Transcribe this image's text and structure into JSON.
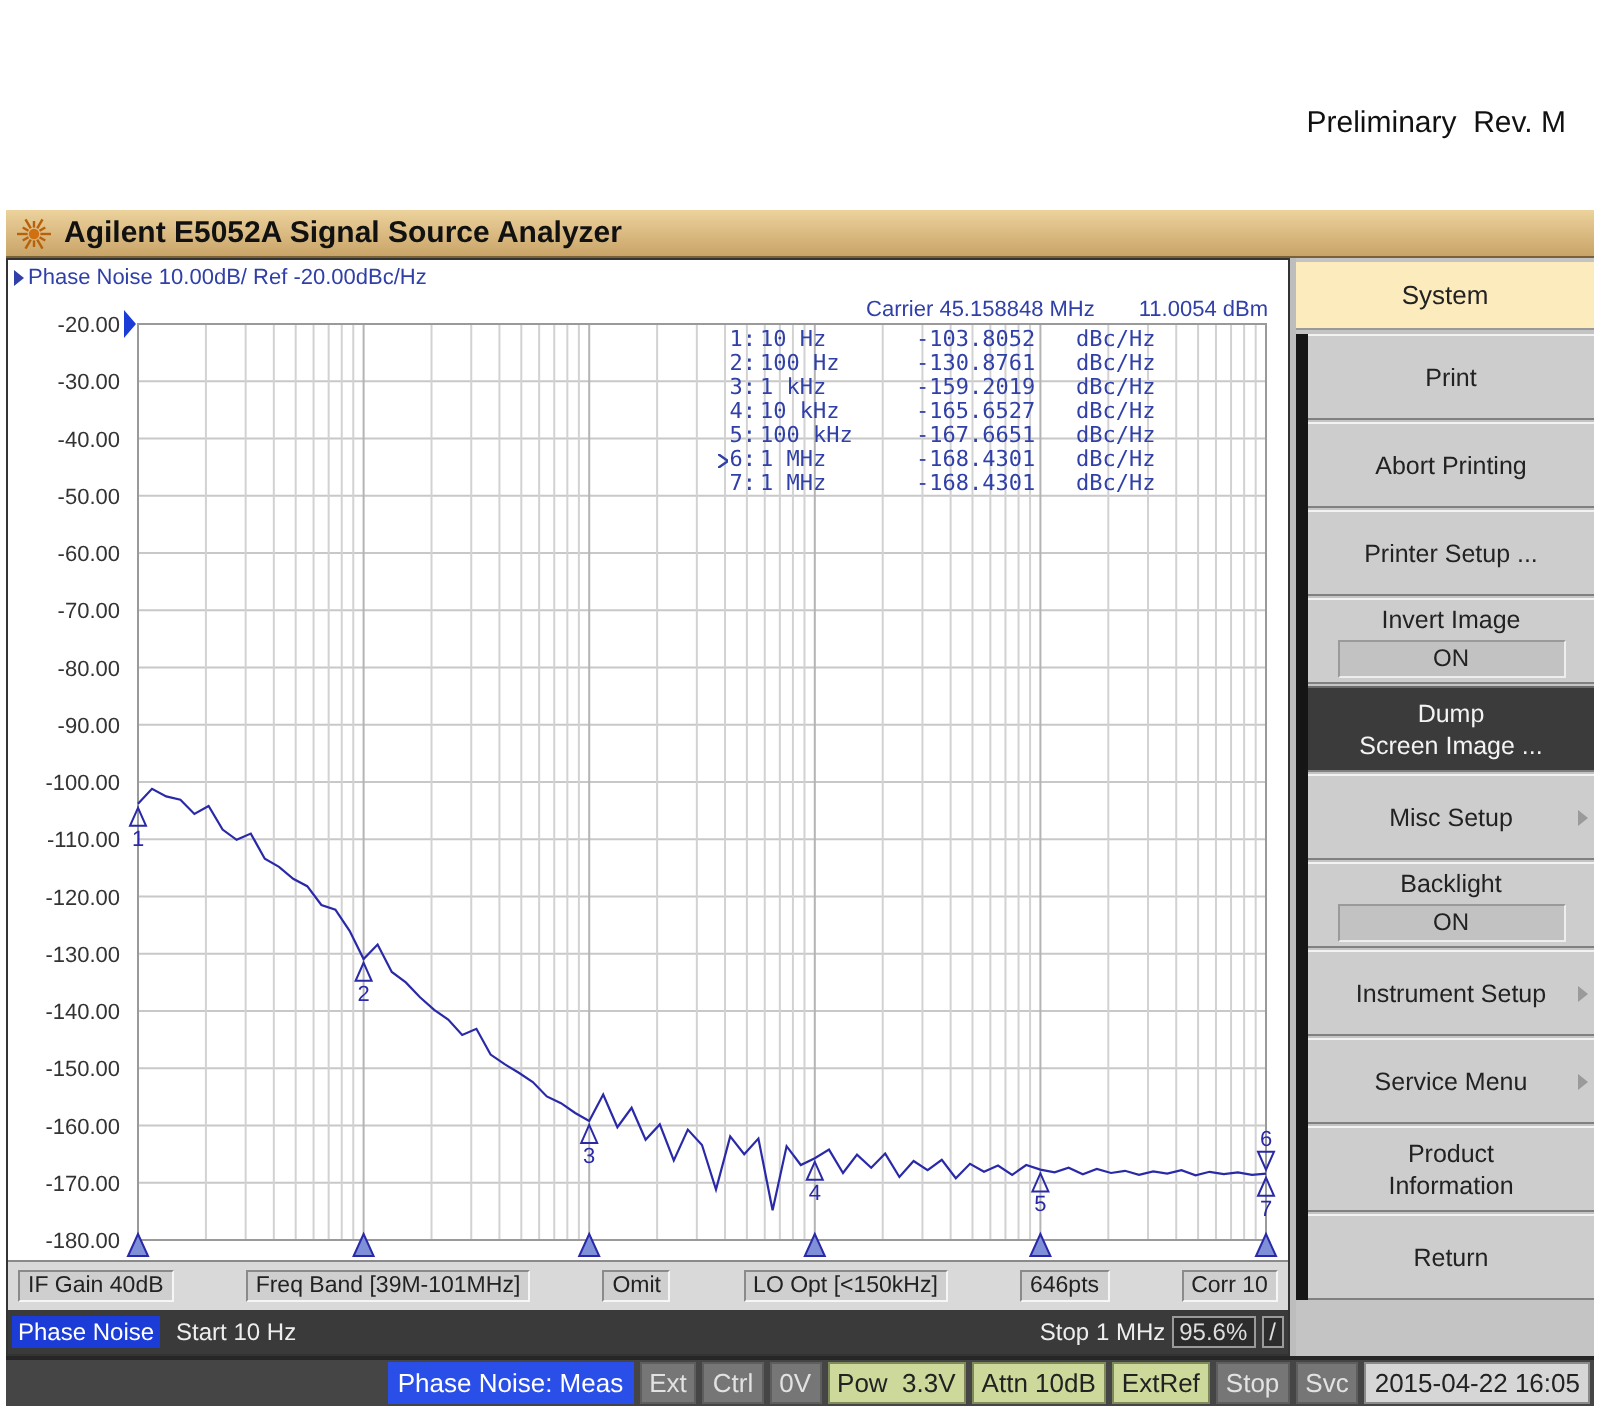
{
  "page_header": {
    "text": "Preliminary  Rev. M"
  },
  "window": {
    "title": "Agilent E5052A Signal Source Analyzer"
  },
  "trace_panel": {
    "carrier": "Carrier 45.158848 MHz",
    "carrier_power": "11.0054 dBm",
    "markers": [
      {
        "number": "1:",
        "stimulus": "10 Hz",
        "value": "-103.8052",
        "unit": "dBc/Hz",
        "selected": false
      },
      {
        "number": "2:",
        "stimulus": "100 Hz",
        "value": "-130.8761",
        "unit": "dBc/Hz",
        "selected": false
      },
      {
        "number": "3:",
        "stimulus": "1 kHz",
        "value": "-159.2019",
        "unit": "dBc/Hz",
        "selected": false
      },
      {
        "number": "4:",
        "stimulus": "10 kHz",
        "value": "-165.6527",
        "unit": "dBc/Hz",
        "selected": false
      },
      {
        "number": "5:",
        "stimulus": "100 kHz",
        "value": "-167.6651",
        "unit": "dBc/Hz",
        "selected": false
      },
      {
        "number": "6:",
        "stimulus": "1 MHz",
        "value": "-168.4301",
        "unit": "dBc/Hz",
        "selected": true
      },
      {
        "number": "7:",
        "stimulus": "1 MHz",
        "value": "-168.4301",
        "unit": "dBc/Hz",
        "selected": false
      }
    ],
    "chart_data": {
      "type": "line",
      "title": "Phase Noise 10.00dB/ Ref -20.00dBc/Hz",
      "categories": [
        null,
        null,
        null,
        null,
        null,
        null,
        null,
        null,
        null,
        null,
        null,
        null,
        null,
        null,
        null,
        null,
        null,
        null,
        null,
        null,
        null,
        null,
        null,
        null,
        null,
        null,
        null,
        null,
        null,
        null,
        null,
        null,
        null,
        null,
        null,
        null,
        null,
        null,
        null,
        null,
        null,
        null,
        null,
        null,
        null,
        null,
        null,
        null,
        null,
        null,
        null,
        null,
        null,
        null,
        null,
        null,
        null,
        null,
        null,
        null,
        null,
        null,
        null,
        null,
        null,
        null,
        null,
        null,
        null,
        null,
        null,
        null,
        null,
        null,
        null,
        null,
        null,
        null,
        null,
        null,
        null
      ],
      "values": [
        -103.8,
        -101.2,
        -102.5,
        -103.1,
        -105.6,
        -104.2,
        -108.3,
        -110.1,
        -109.0,
        -113.4,
        -114.8,
        -116.9,
        -118.2,
        -121.5,
        -122.3,
        -126.0,
        -130.9,
        -128.4,
        -133.2,
        -135.0,
        -137.6,
        -139.8,
        -141.5,
        -144.2,
        -143.1,
        -147.6,
        -149.3,
        -150.8,
        -152.4,
        -154.9,
        -156.1,
        -157.8,
        -159.2,
        -154.6,
        -160.3,
        -156.9,
        -162.5,
        -159.8,
        -166.1,
        -160.7,
        -163.4,
        -171.2,
        -161.9,
        -165.0,
        -162.3,
        -174.8,
        -163.6,
        -166.9,
        -165.7,
        -164.2,
        -168.3,
        -165.1,
        -167.4,
        -164.9,
        -169.0,
        -166.2,
        -167.8,
        -166.0,
        -169.2,
        -166.7,
        -168.1,
        -167.0,
        -168.6,
        -166.9,
        -167.7,
        -168.2,
        -167.4,
        -168.5,
        -167.6,
        -168.3,
        -167.9,
        -168.6,
        -168.0,
        -168.4,
        -167.8,
        -168.7,
        -168.1,
        -168.5,
        -168.2,
        -168.6,
        -168.4
      ],
      "ylim": [
        -180,
        -20
      ],
      "yticks": [
        {
          "value": -20,
          "label": "-20.00"
        },
        {
          "value": -30,
          "label": "-30.00"
        },
        {
          "value": -40,
          "label": "-40.00"
        },
        {
          "value": -50,
          "label": "-50.00"
        },
        {
          "value": -60,
          "label": "-60.00"
        },
        {
          "value": -70,
          "label": "-70.00"
        },
        {
          "value": -80,
          "label": "-80.00"
        },
        {
          "value": -90,
          "label": "-90.00"
        },
        {
          "value": -100,
          "label": "-100.00"
        },
        {
          "value": -110,
          "label": "-110.00"
        },
        {
          "value": -120,
          "label": "-120.00"
        },
        {
          "value": -130,
          "label": "-130.00"
        },
        {
          "value": -140,
          "label": "-140.00"
        },
        {
          "value": -150,
          "label": "-150.00"
        },
        {
          "value": -160,
          "label": "-160.00"
        },
        {
          "value": -170,
          "label": "-170.00"
        },
        {
          "value": -180,
          "label": "-180.00"
        }
      ],
      "grid": true,
      "annotations": [
        {
          "y": -103.8052,
          "text": "1"
        },
        {
          "y": -130.8761,
          "text": "2"
        },
        {
          "y": -159.2019,
          "text": "3"
        },
        {
          "y": -165.6527,
          "text": "4"
        },
        {
          "y": -167.6651,
          "text": "5"
        },
        {
          "y": -168.4301,
          "text": "6"
        },
        {
          "y": -168.4301,
          "text": "7"
        }
      ]
    },
    "settings": [
      "IF Gain 40dB",
      "Freq Band [39M-101MHz]",
      "Omit",
      "LO Opt [<150kHz]",
      "646pts",
      "Corr 10"
    ],
    "sweep": {
      "trace_label": "Phase Noise",
      "start": "Start 10 Hz",
      "stop": "Stop 1 MHz",
      "progress": "95.6%",
      "indicator": "/"
    }
  },
  "softkeys": {
    "title": "System",
    "items": [
      {
        "label": "Print",
        "kind": "action",
        "selected": false
      },
      {
        "label": "Abort Printing",
        "kind": "action",
        "selected": false
      },
      {
        "label": "Printer Setup ...",
        "kind": "action",
        "selected": false
      },
      {
        "label": "Invert Image",
        "kind": "toggle",
        "value": "ON",
        "selected": false
      },
      {
        "label": "Dump\nScreen Image ...",
        "kind": "action",
        "selected": true
      },
      {
        "label": "Misc Setup",
        "kind": "submenu",
        "selected": false
      },
      {
        "label": "Backlight",
        "kind": "toggle",
        "value": "ON",
        "selected": false
      },
      {
        "label": "Instrument Setup",
        "kind": "submenu",
        "selected": false
      },
      {
        "label": "Service Menu",
        "kind": "submenu",
        "selected": false
      },
      {
        "label": "Product\nInformation",
        "kind": "action",
        "selected": false
      },
      {
        "label": "Return",
        "kind": "action",
        "selected": false
      }
    ]
  },
  "status_bar": [
    {
      "label": "Phase Noise: Meas",
      "kind": "mode"
    },
    {
      "label": "Ext",
      "kind": "indicator",
      "on": false
    },
    {
      "label": "Ctrl",
      "kind": "indicator",
      "on": false
    },
    {
      "label": "0V",
      "kind": "indicator",
      "on": false
    },
    {
      "label": "Pow  3.3V",
      "kind": "indicator",
      "on": true
    },
    {
      "label": "Attn 10dB",
      "kind": "indicator",
      "on": true
    },
    {
      "label": "ExtRef",
      "kind": "indicator",
      "on": true
    },
    {
      "label": "Stop",
      "kind": "indicator",
      "on": false
    },
    {
      "label": "Svc",
      "kind": "indicator",
      "on": false
    },
    {
      "label": "2015-04-22 16:05",
      "kind": "clock"
    }
  ]
}
